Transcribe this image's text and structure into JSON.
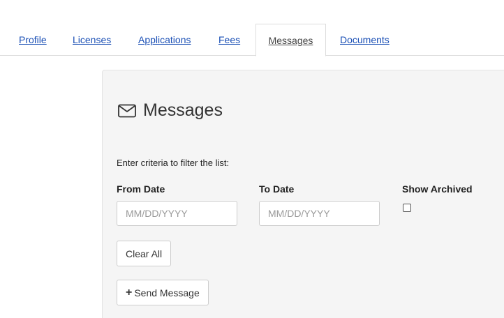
{
  "tabs": [
    {
      "label": "Profile"
    },
    {
      "label": "Licenses"
    },
    {
      "label": "Applications"
    },
    {
      "label": "Fees"
    },
    {
      "label": "Messages",
      "active": true
    },
    {
      "label": "Documents"
    }
  ],
  "panel": {
    "icon": "envelope-icon",
    "title": "Messages",
    "criteria_text": "Enter criteria to filter the list:",
    "from_date": {
      "label": "From Date",
      "placeholder": "MM/DD/YYYY",
      "value": ""
    },
    "to_date": {
      "label": "To Date",
      "placeholder": "MM/DD/YYYY",
      "value": ""
    },
    "show_archived": {
      "label": "Show Archived",
      "checked": false
    },
    "clear_button": "Clear All",
    "send_button": {
      "icon": "plus-icon",
      "label": "Send Message"
    }
  },
  "colors": {
    "link": "#1a4fb5",
    "panel_bg": "#f5f5f5",
    "border": "#dddddd"
  }
}
